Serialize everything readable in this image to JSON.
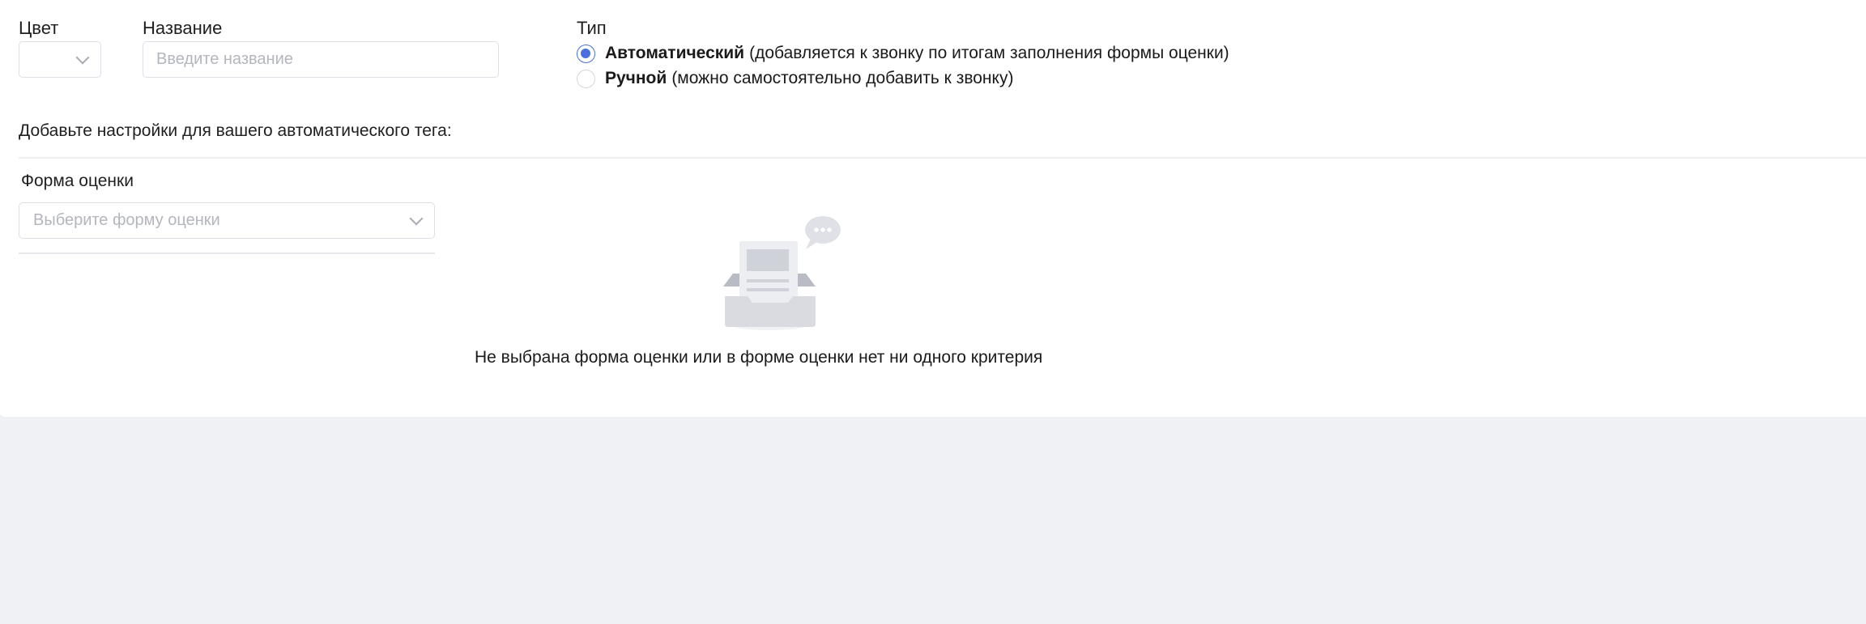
{
  "fields": {
    "color_label": "Цвет",
    "name_label": "Название",
    "name_placeholder": "Введите название",
    "type_label": "Тип"
  },
  "type_options": [
    {
      "title": "Автоматический",
      "description": "(добавляется к звонку по итогам заполнения формы оценки)",
      "checked": true
    },
    {
      "title": "Ручной",
      "description": "(можно самостоятельно добавить к звонку)",
      "checked": false
    }
  ],
  "auto_settings": {
    "heading": "Добавьте настройки для вашего автоматического тега:",
    "form_label": "Форма оценки",
    "form_placeholder": "Выберите форму оценки"
  },
  "empty_state": {
    "message": "Не выбрана форма оценки или в форме оценки нет ни одного критерия",
    "icon": "empty-inbox-icon"
  },
  "colors": {
    "accent": "#4a6ee0",
    "page_background": "#f0f1f5",
    "panel_background": "#ffffff",
    "border": "#dcdfe6",
    "placeholder": "#b3b6bd"
  }
}
